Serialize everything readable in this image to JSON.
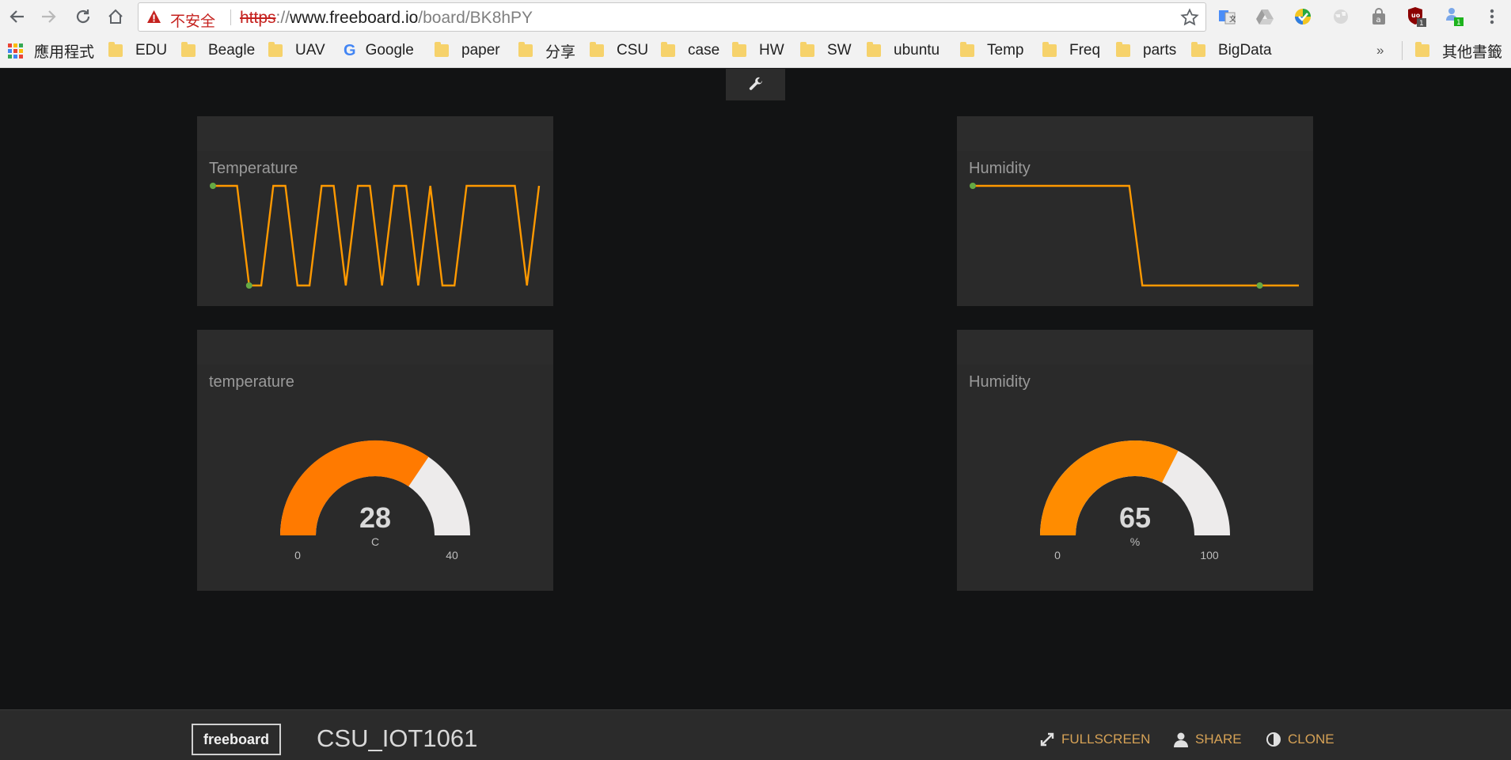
{
  "browser": {
    "insecure_label": "不安全",
    "url_scheme": "https",
    "url_sep": "://",
    "url_host": "www.freeboard.io",
    "url_path": "/board/BK8hPY",
    "bookmarks": [
      {
        "label": "應用程式",
        "kind": "apps"
      },
      {
        "label": "EDU",
        "kind": "folder"
      },
      {
        "label": "Beagle",
        "kind": "folder"
      },
      {
        "label": "UAV",
        "kind": "folder"
      },
      {
        "label": "Google",
        "kind": "google"
      },
      {
        "label": "paper",
        "kind": "folder"
      },
      {
        "label": "分享",
        "kind": "folder"
      },
      {
        "label": "CSU",
        "kind": "folder"
      },
      {
        "label": "case",
        "kind": "folder"
      },
      {
        "label": "HW",
        "kind": "folder"
      },
      {
        "label": "SW",
        "kind": "folder"
      },
      {
        "label": "ubuntu",
        "kind": "folder"
      },
      {
        "label": "Temp",
        "kind": "folder"
      },
      {
        "label": "Freq",
        "kind": "folder"
      },
      {
        "label": "parts",
        "kind": "folder"
      },
      {
        "label": "BigData",
        "kind": "folder"
      }
    ],
    "bookmarks_overflow": "»",
    "other_bookmarks": "其他書籤",
    "extension_badges": [
      "1",
      "1"
    ]
  },
  "widgets": {
    "temp_spark": {
      "title": "Temperature",
      "values": [
        1,
        1,
        1,
        0,
        0,
        1,
        1,
        0,
        0,
        1,
        1,
        0,
        1,
        1,
        0,
        1,
        1,
        0,
        1,
        0,
        0,
        1,
        1,
        1,
        1,
        1,
        0,
        1
      ]
    },
    "hum_spark": {
      "title": "Humidity",
      "values": [
        1,
        1,
        1,
        1,
        1,
        1,
        1,
        1,
        1,
        1,
        1,
        1,
        1,
        0,
        0,
        0,
        0,
        0,
        0,
        0,
        0,
        0,
        0,
        0,
        0,
        0
      ]
    },
    "temp_gauge": {
      "title": "temperature",
      "value": "28",
      "units": "C",
      "min": "0",
      "max": "40",
      "fill_color": "#ff7a00",
      "track_color": "#edebeb"
    },
    "hum_gauge": {
      "title": "Humidity",
      "value": "65",
      "units": "%",
      "min": "0",
      "max": "100",
      "fill_color": "#ff8c00",
      "track_color": "#edebeb"
    }
  },
  "footer": {
    "logo": "freeboard",
    "board_name": "CSU_IOT1061",
    "actions": {
      "fullscreen": "FULLSCREEN",
      "share": "SHARE",
      "clone": "CLONE"
    }
  },
  "colors": {
    "accent": "#d6a256",
    "spark_line": "#ff9900",
    "spark_dot": "#66aa44"
  }
}
